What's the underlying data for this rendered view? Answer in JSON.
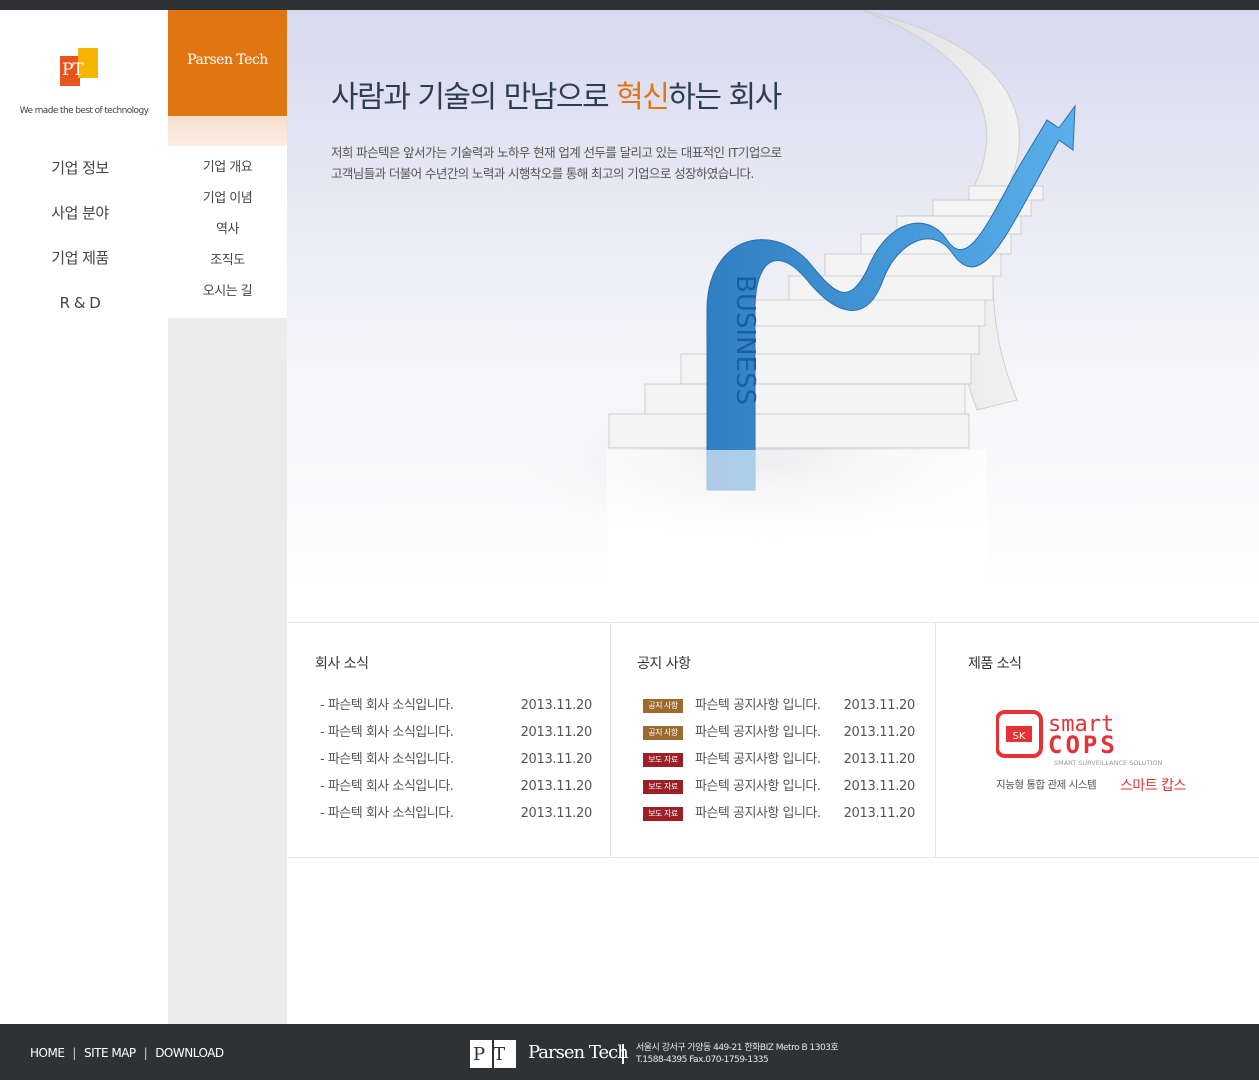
{
  "brand": {
    "logo_text": "PT",
    "tagline": "We made the best of technology",
    "name": "Parsen Tech"
  },
  "nav": {
    "items": [
      {
        "label": "기업 정보"
      },
      {
        "label": "사업 분야"
      },
      {
        "label": "기업 제품"
      },
      {
        "label": "R & D"
      }
    ]
  },
  "subnav": {
    "header": "Parsen Tech",
    "items": [
      {
        "label": "기업 개요"
      },
      {
        "label": "기업 이념"
      },
      {
        "label": "역사"
      },
      {
        "label": "조직도"
      },
      {
        "label": "오시는 길"
      }
    ]
  },
  "hero": {
    "title_before": "사람과 기술의 만남으로 ",
    "title_accent": "혁신",
    "title_after": "하는 회사",
    "desc_line1": "저희 파슨텍은 앞서가는 기술력과 노하우 현재 업계 선두를 달리고 있는 대표적인 IT기업으로",
    "desc_line2": "고객님들과 더불어 수년간의 노력과 시행착오를 통해 최고의 기업으로 성장하였습니다.",
    "ribbon_text": "BUSINESS",
    "colors": {
      "accent": "#e07512",
      "ribbon": "#3e8ed0"
    }
  },
  "company_news": {
    "title": "회사 소식",
    "items": [
      {
        "text": "- 파슨텍 회사 소식입니다.",
        "date": "2013.11.20"
      },
      {
        "text": "- 파슨텍 회사 소식입니다.",
        "date": "2013.11.20"
      },
      {
        "text": "- 파슨텍 회사 소식입니다.",
        "date": "2013.11.20"
      },
      {
        "text": "- 파슨텍 회사 소식입니다.",
        "date": "2013.11.20"
      },
      {
        "text": "- 파슨텍 회사 소식입니다.",
        "date": "2013.11.20"
      }
    ]
  },
  "notices": {
    "title": "공지 사항",
    "items": [
      {
        "badge": "공지 사항",
        "type": "notice",
        "text": "파슨텍 공지사항 입니다.",
        "date": "2013.11.20"
      },
      {
        "badge": "공지 사항",
        "type": "notice",
        "text": "파슨텍 공지사항 입니다.",
        "date": "2013.11.20"
      },
      {
        "badge": "보도 자료",
        "type": "press",
        "text": "파슨텍 공지사항 입니다.",
        "date": "2013.11.20"
      },
      {
        "badge": "보도 자료",
        "type": "press",
        "text": "파슨텍 공지사항 입니다.",
        "date": "2013.11.20"
      },
      {
        "badge": "보도 자료",
        "type": "press",
        "text": "파슨텍 공지사항 입니다.",
        "date": "2013.11.20"
      }
    ]
  },
  "product_news": {
    "title": "제품 소식",
    "logo_word1": "smart",
    "logo_word2": "COPS",
    "logo_sub": "SMART SURVEILLANCE SOLUTION",
    "logo_mark": "SK",
    "tagline": "지능형 통합 관제 시스템",
    "name_kr": "스마트 캅스",
    "color": "#e33335"
  },
  "footer": {
    "links": [
      "HOME",
      "SITE MAP",
      "DOWNLOAD"
    ],
    "separator": "|",
    "logo_text": "PT",
    "company": "Parsen Tech",
    "address": "서울시 강서구 가양동 449-21 한화BIZ Metro B 1303호",
    "contact": "T.1588-4395     Fax.070-1759-1335"
  }
}
